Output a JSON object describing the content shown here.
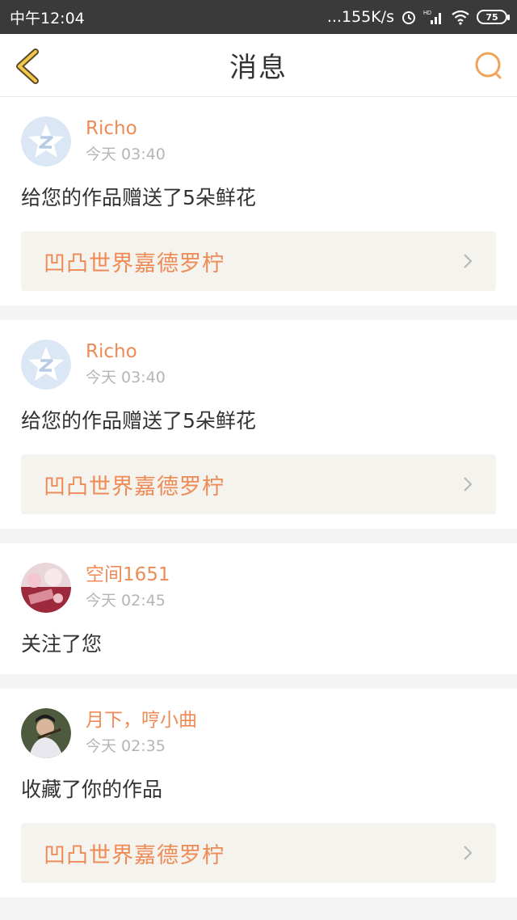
{
  "status_bar": {
    "time": "中午12:04",
    "network_speed": "...155K/s",
    "battery": "75",
    "icons": [
      "alarm-icon",
      "hd-signal-icon",
      "wifi-icon",
      "battery-icon"
    ]
  },
  "nav": {
    "title": "消息",
    "back_icon": "chevron-left-icon",
    "search_icon": "search-icon",
    "accent_color": "#f0a45a"
  },
  "messages": [
    {
      "user": "Richo",
      "time": "今天 03:40",
      "action": "给您的作品赠送了5朵鲜花",
      "work": "凹凸世界嘉德罗柠",
      "avatar": "default-star-avatar"
    },
    {
      "user": "Richo",
      "time": "今天 03:40",
      "action": "给您的作品赠送了5朵鲜花",
      "work": "凹凸世界嘉德罗柠",
      "avatar": "default-star-avatar"
    },
    {
      "user": "空间1651",
      "time": "今天 02:45",
      "action": "关注了您",
      "avatar": "pink-photo-avatar"
    },
    {
      "user": "月下，哼小曲",
      "time": "今天 02:35",
      "action": "收藏了你的作品",
      "work": "凹凸世界嘉德罗柠",
      "avatar": "flute-player-avatar"
    }
  ],
  "colors": {
    "name": "#f08a55",
    "work_bg": "#f4f3ee",
    "page_bg": "#f4f4f4"
  }
}
